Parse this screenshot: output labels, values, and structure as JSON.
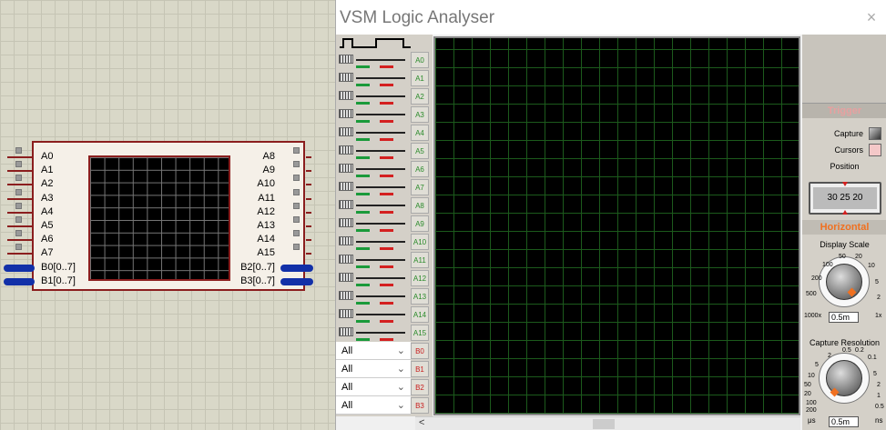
{
  "schematic": {
    "left_pins": [
      "A0",
      "A1",
      "A2",
      "A3",
      "A4",
      "A5",
      "A6",
      "A7",
      "B0[0..7]",
      "B1[0..7]"
    ],
    "right_pins": [
      "A8",
      "A9",
      "A10",
      "A11",
      "A12",
      "A13",
      "A14",
      "A15",
      "B2[0..7]",
      "B3[0..7]"
    ]
  },
  "window": {
    "title": "VSM Logic Analyser",
    "close": "×"
  },
  "channels": [
    "A0",
    "A1",
    "A2",
    "A3",
    "A4",
    "A5",
    "A6",
    "A7",
    "A8",
    "A9",
    "A10",
    "A11",
    "A12",
    "A13",
    "A14",
    "A15"
  ],
  "bus_channels": [
    {
      "select": "All",
      "label": "B0"
    },
    {
      "select": "All",
      "label": "B1"
    },
    {
      "select": "All",
      "label": "B2"
    },
    {
      "select": "All",
      "label": "B3"
    }
  ],
  "trigger": {
    "title": "Trigger",
    "capture_label": "Capture",
    "cursors_label": "Cursors",
    "position_label": "Position",
    "position_ticks": "30  25  20"
  },
  "horizontal": {
    "title": "Horizontal",
    "display_scale_label": "Display Scale",
    "display_scale_value": "0.5m",
    "display_scale_ticks": {
      "t1": "100",
      "t2": "50",
      "t3": "20",
      "t4": "200",
      "t5": "10",
      "t6": "500",
      "t7": "5",
      "t8": "2",
      "t9": "1000x",
      "t10": "1x"
    },
    "capture_resolution_label": "Capture Resolution",
    "capture_resolution_value": "0.5m",
    "capture_resolution_ticks": {
      "t1": "2",
      "t2": "0.5",
      "t3": "0.2",
      "t4": "5",
      "t5": "0.1",
      "t6": "10",
      "t7": "50",
      "t8": "20",
      "t9": "10",
      "t10": "100",
      "t11": "5",
      "t12": "200",
      "t13": "2",
      "t14": "1",
      "t15": "0.5"
    },
    "capture_resolution_units": {
      "left": "μs",
      "right": "ns"
    }
  },
  "colors": {
    "trace_green": "#1a9a3a",
    "trace_red": "#d42020",
    "accent_orange": "#f07020",
    "grid": "#1c5a1c"
  }
}
